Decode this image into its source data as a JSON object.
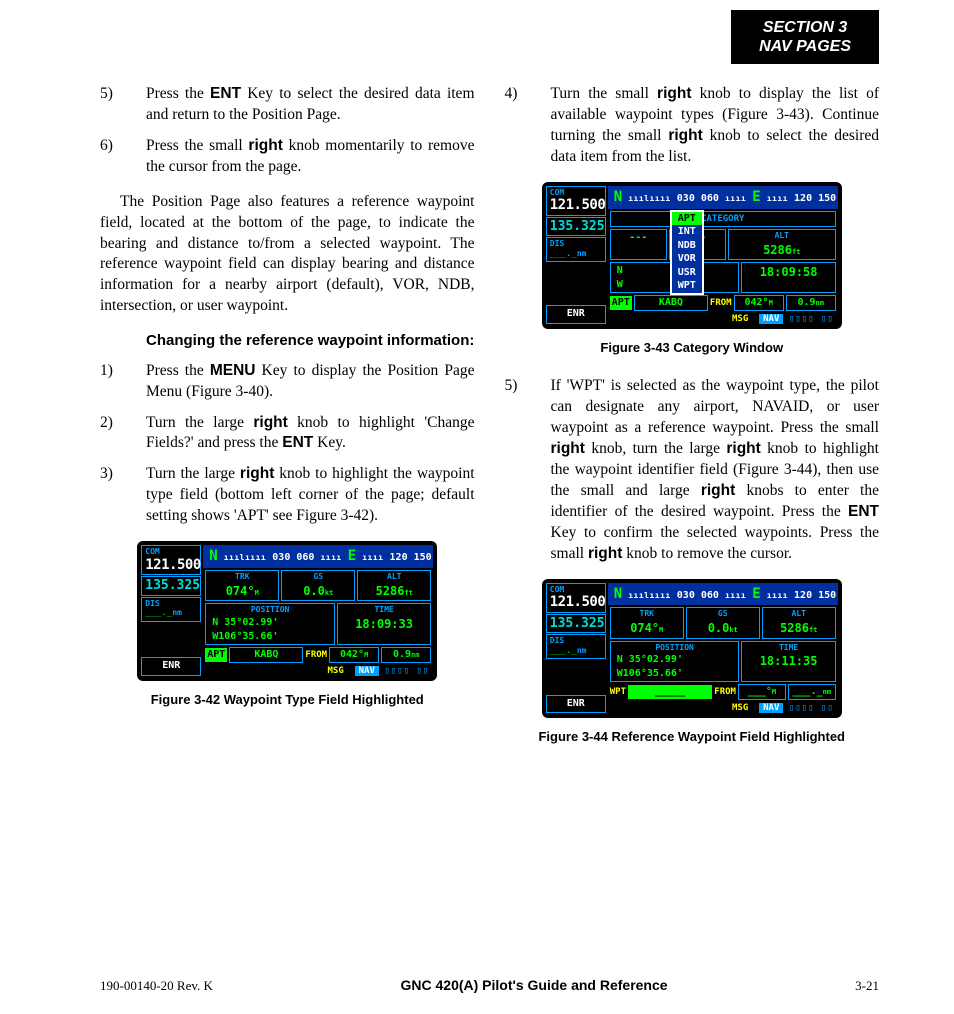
{
  "header": {
    "line1": "SECTION 3",
    "line2": "NAV PAGES"
  },
  "left": {
    "step5": {
      "num": "5)",
      "text_pre": "Press the ",
      "b1": "ENT",
      "text_post": " Key to select the desired data item and return to the Position Page."
    },
    "step6": {
      "num": "6)",
      "text_pre": "Press the small ",
      "b1": "right",
      "text_post": " knob momentarily to remove the cursor from the page."
    },
    "para1": "The Position Page also features a reference waypoint field, located at the bottom of the page, to indicate the bearing and distance to/from a selected waypoint.  The reference waypoint field can display bearing and distance information for a nearby airport (default), VOR, NDB, intersection, or user waypoint.",
    "subhead": "Changing the reference waypoint information:",
    "s1": {
      "num": "1)",
      "pre": "Press the ",
      "b1": "MENU",
      "post": " Key to display the Position Page Menu (Figure 3-40)."
    },
    "s2": {
      "num": "2)",
      "pre": "Turn the large ",
      "b1": "right",
      "mid": " knob to highlight 'Change Fields?' and press the ",
      "b2": "ENT",
      "post": " Key."
    },
    "s3": {
      "num": "3)",
      "pre": "Turn the large ",
      "b1": "right",
      "post": " knob to highlight the waypoint type field (bottom left corner of the page; default setting shows 'APT' see Figure 3-42)."
    },
    "fig42cap": "Figure 3-42  Waypoint Type Field Highlighted"
  },
  "right": {
    "s4": {
      "num": "4)",
      "pre": "Turn the small ",
      "b1": "right",
      "mid1": " knob to display the list of available waypoint types (Figure 3-43).  Continue turning the small ",
      "b2": "right",
      "post": " knob to select the desired data item from the list."
    },
    "fig43cap": "Figure 3-43  Category Window",
    "s5": {
      "num": "5)",
      "pre": "If 'WPT' is selected as the waypoint type, the pilot can designate any airport, NAVAID, or user waypoint as a reference waypoint.  Press the small ",
      "b1": "right",
      "mid1": " knob, turn the large ",
      "b2": "right",
      "mid2": " knob to highlight the waypoint identifier field (Figure 3-44), then use the small and large ",
      "b3": "right",
      "mid3": " knobs to enter the identifier of the desired waypoint.  Press the ",
      "b4": "ENT",
      "mid4": " Key to confirm the selected waypoints.  Press the small ",
      "b5": "right",
      "post": " knob to remove the cursor."
    },
    "fig44cap": "Figure 3-44  Reference Waypoint Field Highlighted"
  },
  "dev": {
    "com_lbl": "COM",
    "com_val": "121.500",
    "com2": "135.325",
    "dis_lbl": "DIS",
    "dis_val": "___._",
    "dis_unit": "nm",
    "enr": "ENR",
    "ruler": {
      "N": "N",
      "nums1": "030  060",
      "E": "E",
      "nums2": "120  150"
    },
    "trk_lbl": "TRK",
    "trk_val": "074°",
    "trk_u": "M",
    "gs_lbl": "GS",
    "gs_val": "0.0",
    "gs_u": "kt",
    "alt_lbl": "ALT",
    "alt_val": "5286",
    "alt_u": "ft",
    "pos_lbl": "POSITION",
    "pos_lat": "N  35°02.99'",
    "pos_lon": "W106°35.66'",
    "time_lbl": "TIME",
    "time42": "18:09:33",
    "time43": "18:09:58",
    "time44": "18:11:35",
    "apt": "APT",
    "kabq": "KABQ",
    "from": "FROM",
    "brg": "042°",
    "brg_u": "M",
    "rng": "0.9",
    "rng_u": "nm",
    "wpt": "WPT",
    "cat_lbl": "CATEGORY",
    "cats": [
      "APT",
      "INT",
      "NDB",
      "VOR",
      "USR",
      "WPT"
    ],
    "msg": "MSG",
    "nav": "NAV"
  },
  "footer": {
    "left": "190-00140-20  Rev. K",
    "mid": "GNC 420(A) Pilot's Guide and Reference",
    "right": "3-21"
  }
}
